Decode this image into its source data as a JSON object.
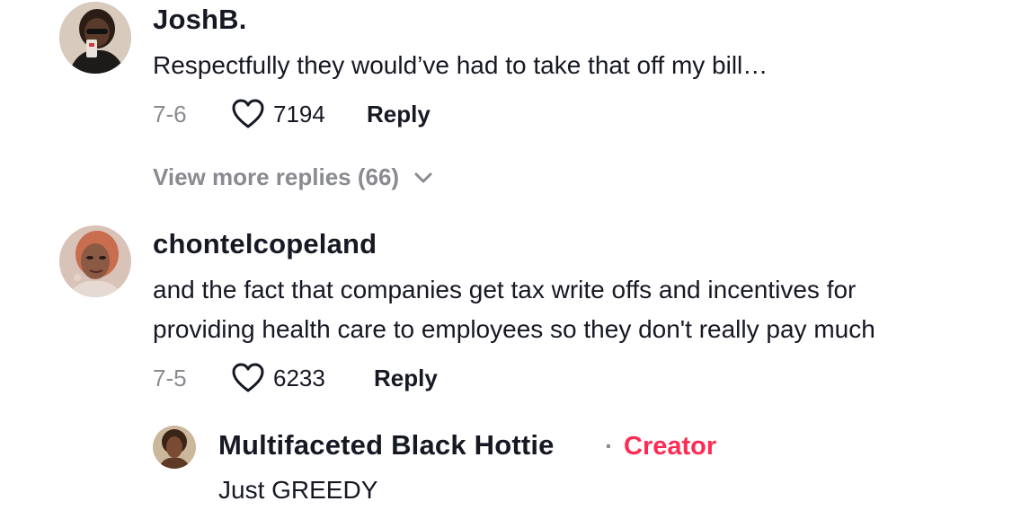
{
  "comments": [
    {
      "username": "JoshB.",
      "text": "Respectfully they would’ve had to take that off my bill…",
      "date": "7-6",
      "likes": "7194",
      "reply_label": "Reply",
      "view_more": "View more replies (66)"
    },
    {
      "username": "chontelcopeland",
      "text_lines": [
        "and the fact that companies get tax write offs and incentives for",
        "providing health care to employees so they don't really pay much"
      ],
      "date": "7-5",
      "likes": "6233",
      "reply_label": "Reply",
      "replies": [
        {
          "username": "Multifaceted Black Hottie",
          "separator": "·",
          "badge": "Creator",
          "text": "Just GREEDY"
        }
      ]
    }
  ],
  "colors": {
    "text_primary": "#161823",
    "text_secondary": "#8a8b91",
    "creator_badge": "#fe2c55"
  },
  "icons": {
    "like": "heart-outline-icon",
    "expand": "chevron-down-icon"
  }
}
